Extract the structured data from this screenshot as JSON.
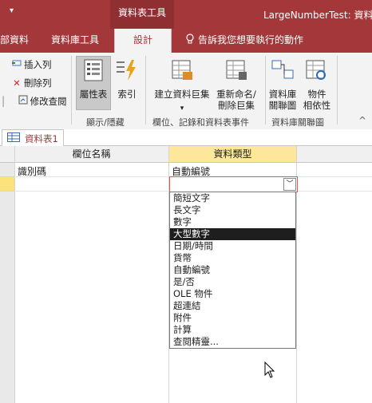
{
  "titlebar": {
    "quick_access": "▾",
    "context_tab": "資料表工具",
    "window_title": "LargeNumberTest: 資料庫"
  },
  "tabs": {
    "external_data": "部資料",
    "db_tools": "資料庫工具",
    "design": "設計",
    "tell_me": "告訴我您想要執行的動作"
  },
  "ribbon": {
    "insert_rows": "插入列",
    "delete_rows": "刪除列",
    "modify_lookups": "修改查閱",
    "property_sheet": "屬性表",
    "indexes": "索引",
    "create_macro_1": "建立資料巨集",
    "rename_macro_1": "重新命名/",
    "rename_macro_2": "刪除巨集",
    "relationships_1": "資料庫",
    "relationships_2": "關聯圖",
    "dependencies_1": "物件",
    "dependencies_2": "相依性",
    "group_show_hide": "顯示/隱藏",
    "group_events": "欄位、記錄和資料表事件",
    "group_relationships": "資料庫關聯圖"
  },
  "document": {
    "tab_label": "資料表1",
    "col_field_name": "欄位名稱",
    "col_data_type": "資料類型",
    "row1_field": "識別碼",
    "row1_type": "自動編號"
  },
  "dropdown": {
    "items": [
      "簡短文字",
      "長文字",
      "數字",
      "大型數字",
      "日期/時間",
      "貨幣",
      "自動編號",
      "是/否",
      "OLE 物件",
      "超連結",
      "附件",
      "計算",
      "查閱精靈..."
    ],
    "highlighted_index": 3
  },
  "colors": {
    "accent": "#a4373a",
    "selected_column": "#fce79b",
    "selected_row": "#fde17a"
  }
}
